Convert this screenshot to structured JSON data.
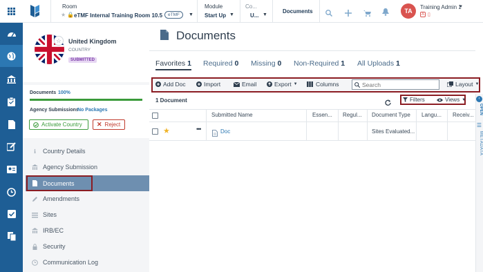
{
  "header": {
    "room_label": "Room",
    "room_name": "eTMF Internal Training Room 10.5",
    "room_badge": "eTMF",
    "module_label": "Module",
    "module_value": "Start Up",
    "co_label": "Co...",
    "co_value": "U...",
    "page_crumb": "Documents",
    "user_initials": "TA",
    "user_name": "Training Admin 1"
  },
  "profile": {
    "country": "United Kingdom",
    "type": "COUNTRY",
    "status": "SUBMITTED"
  },
  "progress": {
    "documents_label": "Documents",
    "documents_pct": "100%",
    "documents_fill": 1.0,
    "agency_label": "Agency Submissions",
    "agency_value": "No Packages",
    "activate_label": "Activate Country",
    "reject_label": "Reject"
  },
  "nav": [
    {
      "label": "Country Details",
      "icon": "info-icon"
    },
    {
      "label": "Agency Submission",
      "icon": "building-icon"
    },
    {
      "label": "Documents",
      "icon": "document-icon"
    },
    {
      "label": "Amendments",
      "icon": "pencil-icon"
    },
    {
      "label": "Sites",
      "icon": "list-icon"
    },
    {
      "label": "IRB/EC",
      "icon": "building-icon"
    },
    {
      "label": "Security",
      "icon": "lock-icon"
    },
    {
      "label": "Communication Log",
      "icon": "clock-icon"
    }
  ],
  "main": {
    "title": "Documents",
    "tabs": [
      {
        "label": "Favorites",
        "count": "1"
      },
      {
        "label": "Required",
        "count": "0"
      },
      {
        "label": "Missing",
        "count": "0"
      },
      {
        "label": "Non-Required",
        "count": "1"
      },
      {
        "label": "All Uploads",
        "count": "1"
      }
    ],
    "toolbar": {
      "add_doc": "Add Doc",
      "import": "Import",
      "email": "Email",
      "export": "Export",
      "columns": "Columns",
      "search_placeholder": "Search",
      "layout": "Layout"
    },
    "count_label": "1 Document",
    "filters": "Filters",
    "views": "Views",
    "columns": [
      "Submitted Name",
      "Essen...",
      "Regul...",
      "Document Type",
      "Langu...",
      "Receiv..."
    ],
    "rows": [
      {
        "name": "Doc",
        "doc_type": "Sites Evaluated..."
      }
    ]
  },
  "right_panel": {
    "open_label": "OPEN",
    "metadata_label": "METADATA"
  },
  "colors": {
    "rail": "#1e5e95",
    "accent": "#2c78b3",
    "highlight_border": "#8b1c22",
    "success": "#3a9a3a",
    "danger": "#c0392b",
    "avatar": "#d9534f"
  }
}
